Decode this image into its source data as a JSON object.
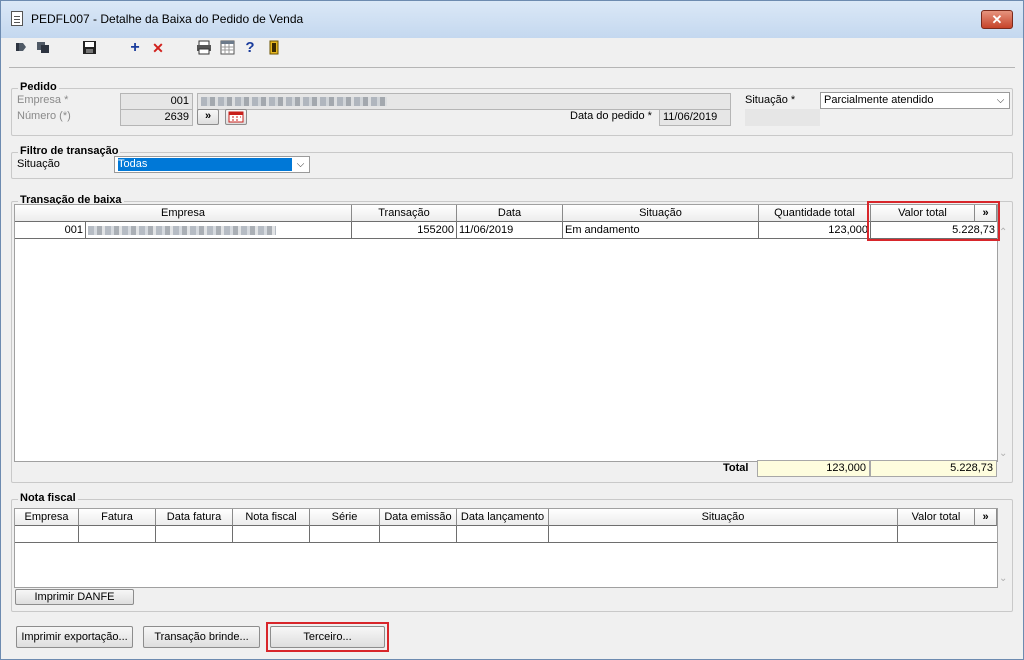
{
  "window": {
    "title": "PEDFL007 - Detalhe da Baixa do Pedido de Venda",
    "close_label": "✕"
  },
  "toolbar": {
    "icons": [
      "nav-first-icon",
      "nav-prev-icon",
      "save-icon",
      "add-icon",
      "delete-icon",
      "print-icon",
      "calendar-grid-icon",
      "help-icon",
      "exit-icon"
    ]
  },
  "pedido": {
    "title": "Pedido",
    "empresa_label": "Empresa *",
    "empresa_code": "001",
    "numero_label": "Número (*)",
    "numero_value": "2639",
    "more_label": "»",
    "data_label": "Data do pedido *",
    "data_value": "11/06/2019",
    "situacao_label": "Situação *",
    "situacao_value": "Parcialmente atendido"
  },
  "filtro": {
    "title": "Filtro de transação",
    "situacao_label": "Situação",
    "situacao_value": "Todas"
  },
  "transacao": {
    "title": "Transação de baixa",
    "columns": [
      "Empresa",
      "Transação",
      "Data",
      "Situação",
      "Quantidade total",
      "Valor total",
      "»"
    ],
    "rows": [
      {
        "empresa": "001",
        "transacao": "155200",
        "data": "11/06/2019",
        "situacao": "Em andamento",
        "quantidade": "123,000",
        "valor": "5.228,73"
      }
    ],
    "total_label": "Total",
    "total_quantidade": "123,000",
    "total_valor": "5.228,73"
  },
  "nota": {
    "title": "Nota fiscal",
    "columns": [
      "Empresa",
      "Fatura",
      "Data fatura",
      "Nota fiscal",
      "Série",
      "Data emissão",
      "Data lançamento",
      "Situação",
      "Valor total",
      "»"
    ],
    "imprimir_danfe": "Imprimir DANFE"
  },
  "footer": {
    "imprimir_exportacao": "Imprimir exportação...",
    "transacao_brinde": "Transação brinde...",
    "terceiro": "Terceiro..."
  },
  "colors": {
    "highlight": "#d8262b",
    "selection": "#0078d7",
    "total_bg": "#fefdde"
  }
}
